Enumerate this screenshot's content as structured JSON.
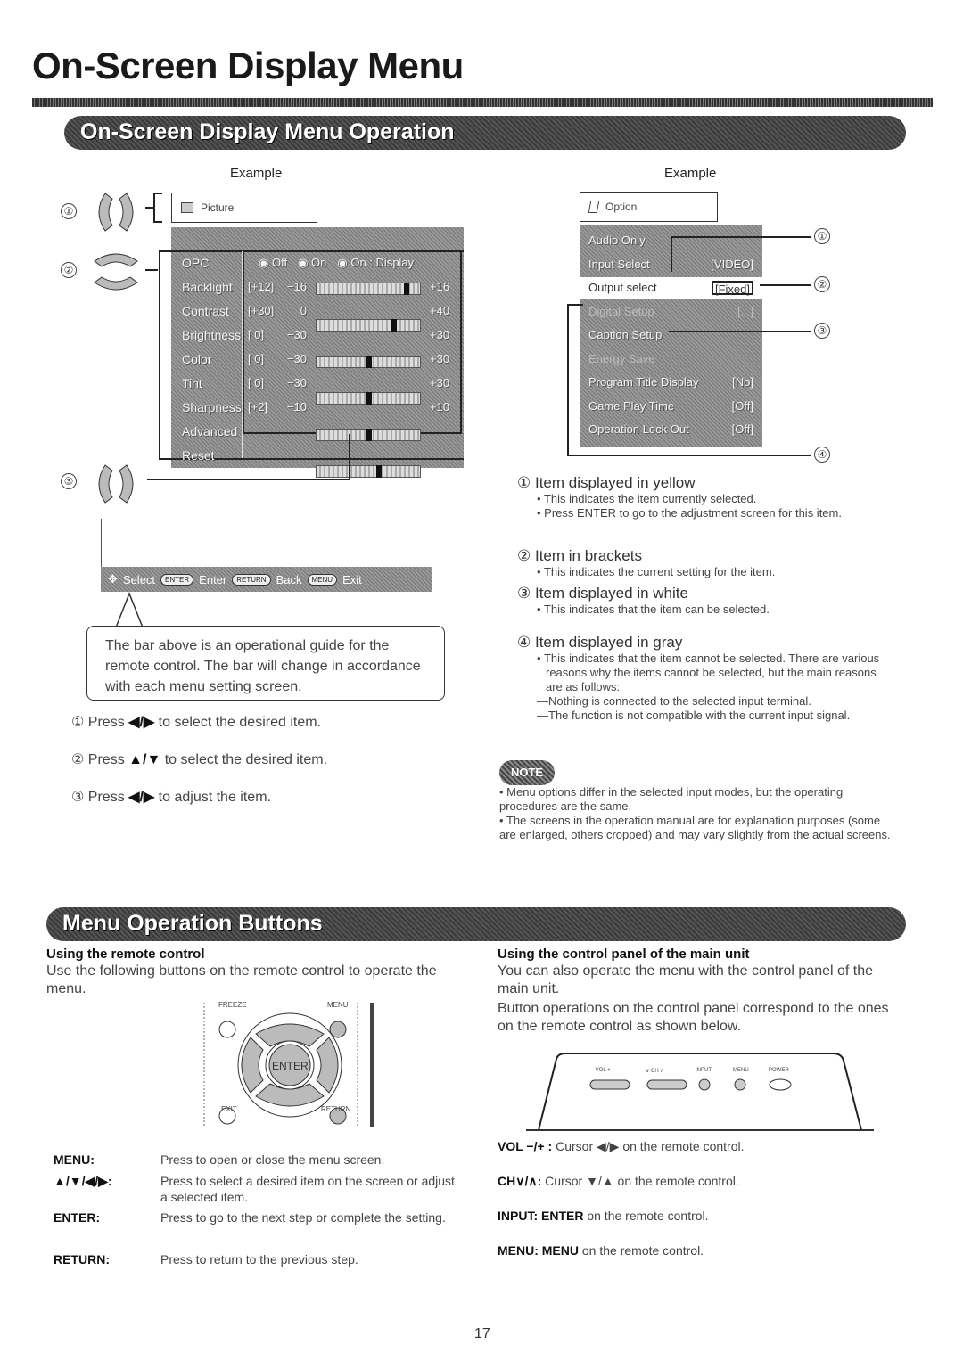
{
  "page": {
    "title": "On-Screen Display Menu",
    "page_number": "17"
  },
  "section1": {
    "banner": "On-Screen Display Menu Operation",
    "left_example": {
      "label": "Example",
      "markers": [
        "①",
        "②",
        "③"
      ],
      "menu_title": "Picture",
      "menu_icon": "picture-icon",
      "opc": {
        "label": "OPC",
        "options": [
          "Off",
          "On",
          "On : Display"
        ]
      },
      "rows": [
        {
          "label": "Backlight",
          "value": "[+12]",
          "min": "−16",
          "max": "+16",
          "position": 0.875
        },
        {
          "label": "Contrast",
          "value": "[+30]",
          "min": "0",
          "max": "+40",
          "position": 0.75
        },
        {
          "label": "Brightness",
          "value": "[ 0]",
          "min": "−30",
          "max": "+30",
          "position": 0.5
        },
        {
          "label": "Color",
          "value": "[ 0]",
          "min": "−30",
          "max": "+30",
          "position": 0.5
        },
        {
          "label": "Tint",
          "value": "[ 0]",
          "min": "−30",
          "max": "+30",
          "position": 0.5
        },
        {
          "label": "Sharpness",
          "value": "[+2]",
          "min": "−10",
          "max": "+10",
          "position": 0.6
        }
      ],
      "extra_items": [
        "Advanced",
        "Reset"
      ],
      "guide_bar": {
        "select_icon": "dpad-icon",
        "select": "Select",
        "enter_key": "ENTER",
        "enter": "Enter",
        "return_key": "RETURN",
        "back": "Back",
        "menu_key": "MENU",
        "exit": "Exit"
      },
      "callout": "The bar above is an operational guide for the remote control. The bar will change in accordance with each menu setting screen."
    },
    "steps": [
      {
        "num": "①",
        "pre": "Press",
        "keys": "◀/▶",
        "post": "to select the desired item."
      },
      {
        "num": "②",
        "pre": "Press",
        "keys": "▲/▼",
        "post": "to select the desired item."
      },
      {
        "num": "③",
        "pre": "Press",
        "keys": "◀/▶",
        "post": "to adjust the item."
      }
    ],
    "right_example": {
      "label": "Example",
      "menu_title": "Option",
      "menu_icon": "option-icon",
      "rows": [
        {
          "label": "Audio Only",
          "value": "",
          "state": "white"
        },
        {
          "label": "Input Select",
          "value": "[VIDEO]",
          "state": "white"
        },
        {
          "label": "Output select",
          "value": "[Fixed]",
          "state": "selected"
        },
        {
          "label": "Digital Setup",
          "value": "[...]",
          "state": "gray"
        },
        {
          "label": "Caption Setup",
          "value": "",
          "state": "white"
        },
        {
          "label": "Energy Save",
          "value": "",
          "state": "gray"
        },
        {
          "label": "Program Title Display",
          "value": "[No]",
          "state": "white"
        },
        {
          "label": "Game Play Time",
          "value": "[Off]",
          "state": "white"
        },
        {
          "label": "Operation Lock Out",
          "value": "[Off]",
          "state": "white"
        }
      ],
      "markers": [
        "①",
        "②",
        "③",
        "④"
      ]
    },
    "legend": [
      {
        "num": "①",
        "title": "Item displayed in yellow",
        "bullets": [
          "This indicates the item currently selected.",
          "Press ENTER to go to the adjustment screen for this item."
        ]
      },
      {
        "num": "②",
        "title": "Item in brackets",
        "bullets": [
          "This indicates the current setting for the item."
        ]
      },
      {
        "num": "③",
        "title": "Item displayed in white",
        "bullets": [
          "This indicates that the item can be selected."
        ]
      },
      {
        "num": "④",
        "title": "Item displayed in gray",
        "bullets": [
          "This indicates that the item cannot be selected. There are various reasons why the items cannot be selected, but the main reasons are as follows:"
        ],
        "dashes": [
          "Nothing is connected to the selected input terminal.",
          "The function is not compatible with the current input signal."
        ]
      }
    ],
    "note": {
      "badge": "NOTE",
      "bullets": [
        "Menu options differ in the selected input modes, but the operating procedures are the same.",
        "The screens in the operation manual are for explanation purposes (some are enlarged, others cropped) and may vary slightly from the actual screens."
      ]
    }
  },
  "section2": {
    "banner": "Menu Operation Buttons",
    "remote": {
      "heading": "Using the remote control",
      "intro": "Use the following buttons on the remote control to operate the menu.",
      "diagram": {
        "freeze": "FREEZE",
        "menu": "MENU",
        "enter": "ENTER",
        "exit": "EXIT",
        "return": "RETURN"
      },
      "definitions": [
        {
          "term": "MENU:",
          "desc": "Press to open or close the menu screen."
        },
        {
          "term": "▲/▼/◀/▶:",
          "desc": "Press to select a desired item on the screen or adjust a selected item."
        },
        {
          "term": "ENTER:",
          "desc": "Press to go to the next step or complete the setting."
        },
        {
          "term": "RETURN:",
          "desc": "Press to return to the previous step."
        }
      ]
    },
    "panel": {
      "heading": "Using the control panel of the main unit",
      "intro1": "You can also operate the menu with the control panel of the main unit.",
      "intro2": "Button operations on the control panel correspond to the ones on the remote control as shown below.",
      "diagram": {
        "vol": "— VOL +",
        "ch": "∨ CH ∧",
        "input": "INPUT",
        "menu": "MENU",
        "power": "POWER"
      },
      "mappings": [
        {
          "term": "VOL −/+ :",
          "desc": "Cursor ◀/▶ on the remote control."
        },
        {
          "term": "CH∨/∧:",
          "desc": "Cursor ▼/▲ on the remote control."
        },
        {
          "term": "INPUT: ENTER",
          "desc": "on the remote control."
        },
        {
          "term": "MENU: MENU",
          "desc": "on the remote control."
        }
      ]
    }
  }
}
